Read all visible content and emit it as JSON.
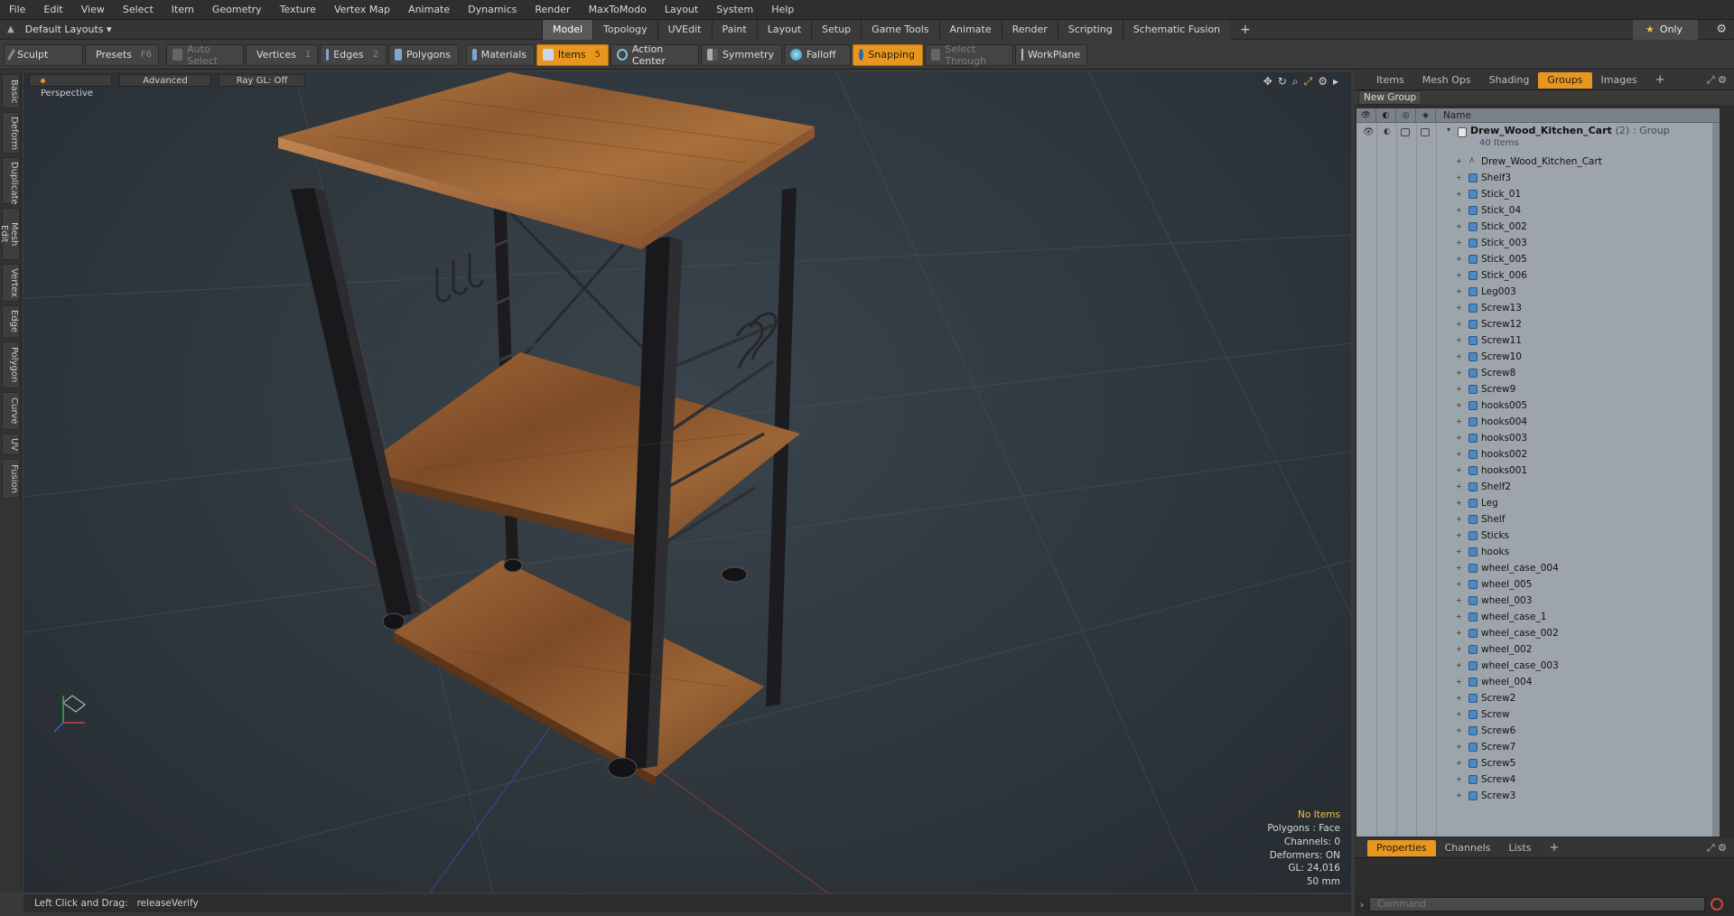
{
  "menu": [
    "File",
    "Edit",
    "View",
    "Select",
    "Item",
    "Geometry",
    "Texture",
    "Vertex Map",
    "Animate",
    "Dynamics",
    "Render",
    "MaxToModo",
    "Layout",
    "System",
    "Help"
  ],
  "layout": {
    "dropdown_label": "Default Layouts ▾"
  },
  "mode_tabs": [
    {
      "label": "Model",
      "active": true
    },
    {
      "label": "Topology"
    },
    {
      "label": "UVEdit"
    },
    {
      "label": "Paint"
    },
    {
      "label": "Layout"
    },
    {
      "label": "Setup"
    },
    {
      "label": "Game Tools"
    },
    {
      "label": "Animate"
    },
    {
      "label": "Render"
    },
    {
      "label": "Scripting"
    },
    {
      "label": "Schematic Fusion"
    }
  ],
  "mode_plus": "+",
  "only_label": "Only",
  "toolbar": {
    "sculpt": "Sculpt",
    "presets": "Presets",
    "presets_key": "F6",
    "auto_select": "Auto Select",
    "vertices": "Vertices",
    "vertices_key": "1",
    "edges": "Edges",
    "edges_key": "2",
    "polygons": "Polygons",
    "materials": "Materials",
    "items": "Items",
    "items_key": "5",
    "action_center": "Action Center",
    "symmetry": "Symmetry",
    "falloff": "Falloff",
    "snapping": "Snapping",
    "select_through": "Select Through",
    "workplane": "WorkPlane"
  },
  "left_tabs": [
    "Basic",
    "Deform",
    "Duplicate",
    "Mesh Edit",
    "Vertex",
    "Edge",
    "Polygon",
    "Curve",
    "UV",
    "Fusion"
  ],
  "viewport": {
    "perspective": "Perspective",
    "advanced": "Advanced",
    "raygl": "Ray GL: Off",
    "stats": {
      "no_items": "No Items",
      "polygons": "Polygons : Face",
      "channels": "Channels: 0",
      "deformers": "Deformers: ON",
      "gl": "GL: 24,016",
      "size": "50 mm"
    }
  },
  "status": {
    "label": "Left Click and Drag:",
    "value": "releaseVerify"
  },
  "right_panel": {
    "tabs": [
      {
        "label": "Items"
      },
      {
        "label": "Mesh Ops"
      },
      {
        "label": "Shading"
      },
      {
        "label": "Groups",
        "active": true
      },
      {
        "label": "Images"
      }
    ],
    "tabs_plus": "+",
    "new_group": "New Group",
    "col_name": "Name",
    "group": {
      "name": "Drew_Wood_Kitchen_Cart",
      "count": "(2)",
      "type": ": Group",
      "sub": "40 Items"
    },
    "items": [
      "Drew_Wood_Kitchen_Cart",
      "Shelf3",
      "Stick_01",
      "Stick_04",
      "Stick_002",
      "Stick_003",
      "Stick_005",
      "Stick_006",
      "Leg003",
      "Screw13",
      "Screw12",
      "Screw11",
      "Screw10",
      "Screw8",
      "Screw9",
      "hooks005",
      "hooks004",
      "hooks003",
      "hooks002",
      "hooks001",
      "Shelf2",
      "Leg",
      "Shelf",
      "Sticks",
      "hooks",
      "wheel_case_004",
      "wheel_005",
      "wheel_003",
      "wheel_case_1",
      "wheel_case_002",
      "wheel_002",
      "wheel_case_003",
      "wheel_004",
      "Screw2",
      "Screw",
      "Screw6",
      "Screw7",
      "Screw5",
      "Screw4",
      "Screw3"
    ],
    "bottom_tabs": [
      {
        "label": "Properties",
        "active": true
      },
      {
        "label": "Channels"
      },
      {
        "label": "Lists"
      }
    ],
    "bottom_plus": "+",
    "command_placeholder": "Command"
  },
  "colors": {
    "accent": "#e8961e",
    "wood": "#a86b3a",
    "metal": "#1e1e20"
  }
}
